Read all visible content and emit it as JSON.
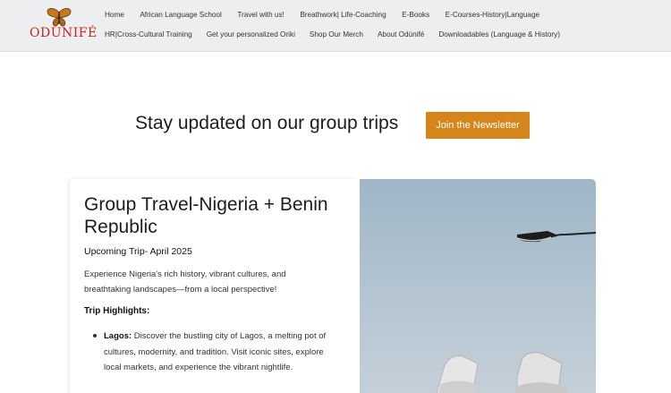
{
  "brand": {
    "logo_text": "ODÚNIFÉ",
    "accent": "#c8261f"
  },
  "nav": {
    "row1": [
      "Home",
      "African Language School",
      "Travel with us!",
      "Breathwork| Life-Coaching",
      "E-Books",
      "E-Courses-History|Language"
    ],
    "row2": [
      "HR|Cross-Cultural Training",
      "Get your personalized Oriki",
      "Shop Our Merch",
      "About Odúnifé",
      "Downloadables (Language & History)"
    ]
  },
  "hero": {
    "text": "Stay updated on our group trips",
    "button_label": "Join the Newsletter",
    "button_color": "#d6851a"
  },
  "card": {
    "title": "Group Travel-Nigeria + Benin Republic",
    "subtitle": "Upcoming Trip- April 2025",
    "description": "Experience Nigeria's rich history, vibrant cultures, and breathtaking landscapes—from a local perspective!",
    "highlights_label": "Trip Highlights:",
    "highlights": [
      {
        "place": "Lagos:",
        "text": " Discover the bustling city of Lagos, a melting pot of cultures, modernity, and tradition. Visit iconic sites, explore local markets, and experience the vibrant nightlife."
      }
    ]
  }
}
